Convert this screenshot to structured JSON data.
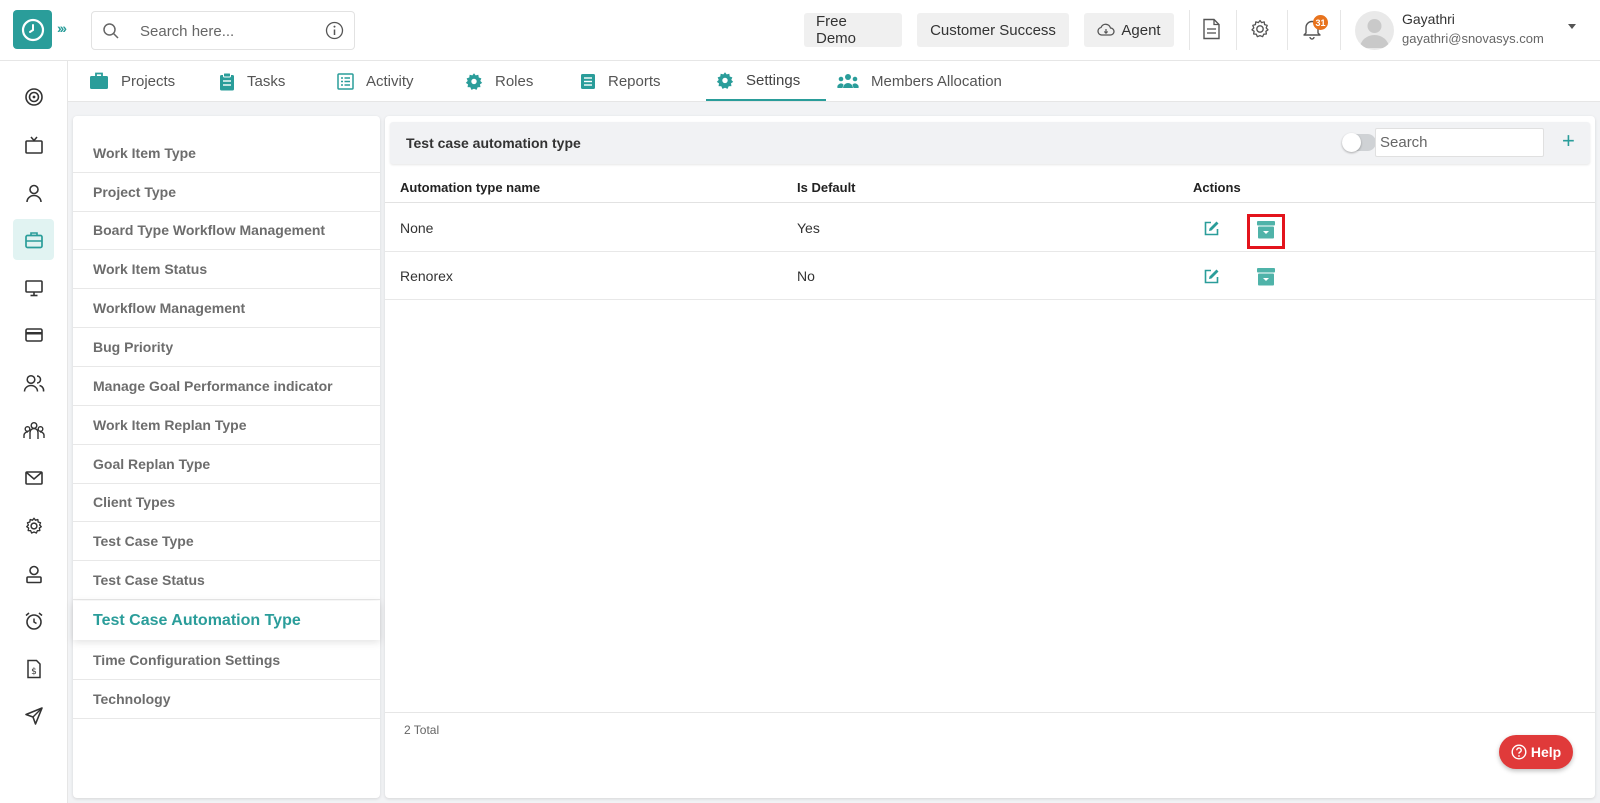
{
  "header": {
    "search_placeholder": "Search here...",
    "buttons": {
      "free_demo": "Free Demo",
      "customer_success": "Customer Success",
      "agent": "Agent"
    },
    "notification_count": "31",
    "user": {
      "name": "Gayathri",
      "email": "gayathri@snovasys.com"
    }
  },
  "nav_tabs": [
    {
      "label": "Projects",
      "icon": "briefcase-icon"
    },
    {
      "label": "Tasks",
      "icon": "clipboard-icon"
    },
    {
      "label": "Activity",
      "icon": "list-icon"
    },
    {
      "label": "Roles",
      "icon": "gear-icon"
    },
    {
      "label": "Reports",
      "icon": "report-icon"
    },
    {
      "label": "Settings",
      "icon": "gear-icon",
      "active": true
    },
    {
      "label": "Members Allocation",
      "icon": "people-icon"
    }
  ],
  "settings_menu": [
    "Work Item Type",
    "Project Type",
    "Board Type Workflow Management",
    "Work Item Status",
    "Workflow Management",
    "Bug Priority",
    "Manage Goal Performance indicator",
    "Work Item Replan Type",
    "Goal Replan Type",
    "Client Types",
    "Test Case Type",
    "Test Case Status",
    "Test Case Automation Type",
    "Time Configuration Settings",
    "Technology"
  ],
  "active_menu_item": "Test Case Automation Type",
  "panel": {
    "title": "Test case automation type",
    "search_placeholder": "Search",
    "add_label": "+",
    "columns": [
      "Automation type name",
      "Is Default",
      "Actions"
    ],
    "rows": [
      {
        "name": "None",
        "is_default": "Yes"
      },
      {
        "name": "Renorex",
        "is_default": "No"
      }
    ],
    "total": "2 Total"
  },
  "help_label": "Help",
  "colors": {
    "accent": "#2a9d9a",
    "highlight": "#e3141c",
    "badge": "#e8731d",
    "help": "#e03a3a"
  }
}
